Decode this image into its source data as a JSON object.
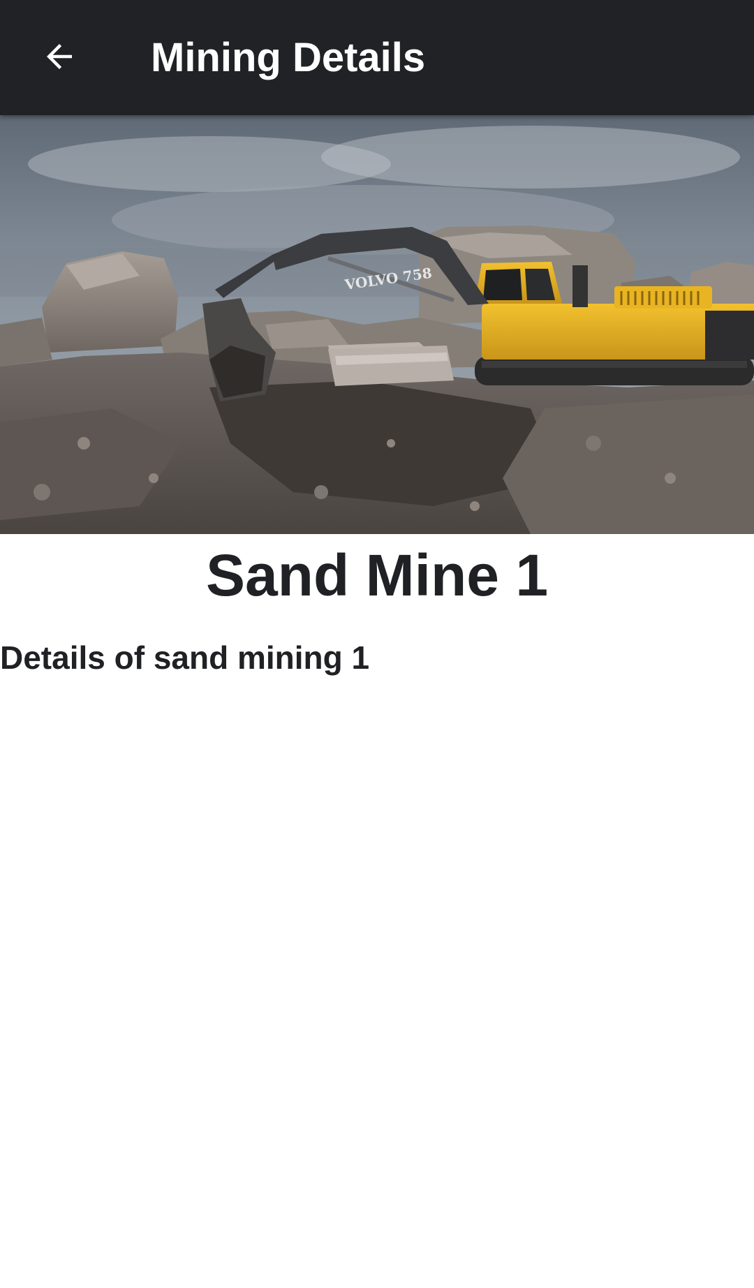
{
  "toolbar": {
    "title": "Mining Details",
    "back_icon": "arrow-back-icon",
    "background_color": "#202225"
  },
  "hero": {
    "machine_label": "VOLVO 758"
  },
  "mine": {
    "title": "Sand Mine 1",
    "details": "Details of sand mining 1"
  }
}
